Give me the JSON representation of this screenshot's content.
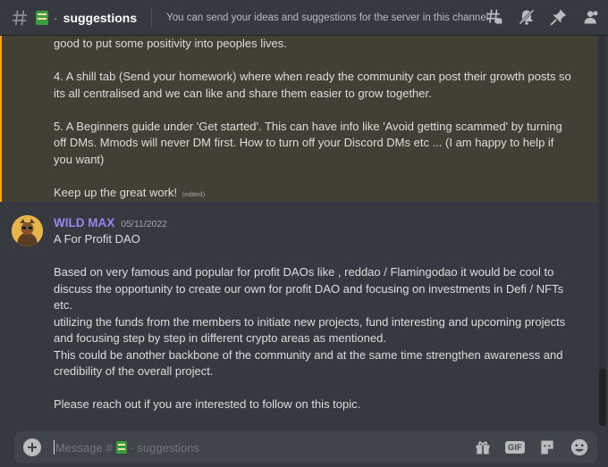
{
  "header": {
    "channel_name": "suggestions",
    "channel_separator": "·",
    "topic": "You can send your ideas and suggestions for the server in this channel.",
    "icons": [
      "threads-icon",
      "notification-muted-icon",
      "pin-icon",
      "member-list-icon"
    ]
  },
  "highlighted_message": {
    "lines": [
      "good to put some positivity into peoples lives.",
      "",
      "4. A shill tab (Send your homework) where when ready the community can post their growth posts so",
      "its all centralised and we can like and share them easier to grow together.",
      "",
      "5. A Beginners guide under 'Get started'. This can have info like 'Avoid getting scammed' by turning",
      "off DMs. Mmods will never DM first. How to turn off your Discord DMs etc ... (I am happy to help if",
      "you want)",
      ""
    ],
    "closing": "Keep up the great work!",
    "edited_tag": "(edited)",
    "accent_color": "#faa81a"
  },
  "message": {
    "author": "WILD MAX",
    "timestamp": "05/11/2022",
    "author_color": "#9b84ee",
    "lines": [
      "A For Profit DAO",
      "",
      "Based on very famous and popular for profit DAOs like , reddao / Flamingodao it would be cool to",
      "discuss the opportunity to create our own for profit DAO and focusing on investments in Defi / NFTs",
      "etc.",
      "utilizing the funds from the members to initiate new projects, fund interesting and upcoming projects",
      "and focusing step by step in different crypto areas as mentioned.",
      "This could be another backbone of the community and at the same time strengthen awareness and",
      "credibility of the overall project.",
      "",
      "Please reach out if you are interested to follow on this topic."
    ]
  },
  "composer": {
    "placeholder_prefix": "Message #",
    "placeholder_channel": "· suggestions",
    "gif_label": "GIF",
    "icons": [
      "gift-icon",
      "gif-icon",
      "sticker-icon",
      "emoji-icon"
    ]
  }
}
